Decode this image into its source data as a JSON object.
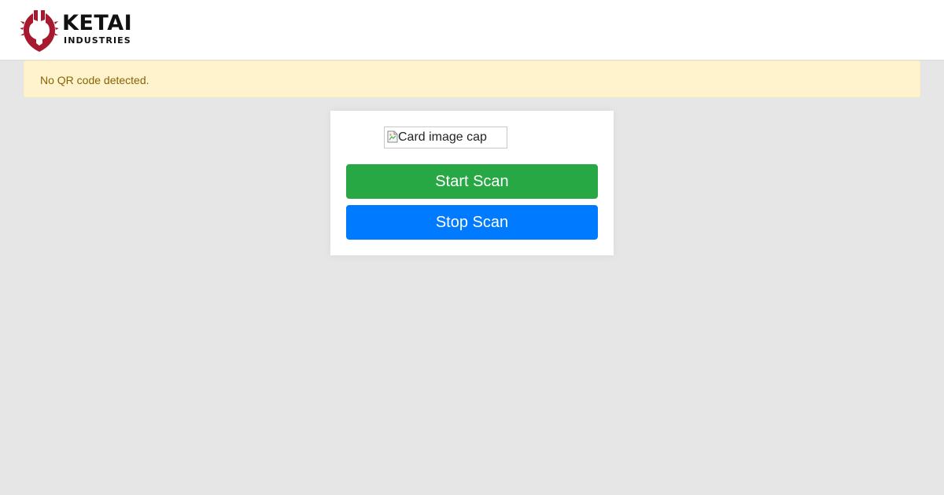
{
  "header": {
    "logo_word": "KETAI",
    "logo_sub": "INDUSTRIES",
    "brand_color": "#a6192e"
  },
  "alert": {
    "message": "No QR code detected.",
    "status": "warning"
  },
  "scanner_card": {
    "image_alt": "Card image cap",
    "start_label": "Start Scan",
    "stop_label": "Stop Scan",
    "start_color": "#28a745",
    "stop_color": "#007bff"
  }
}
